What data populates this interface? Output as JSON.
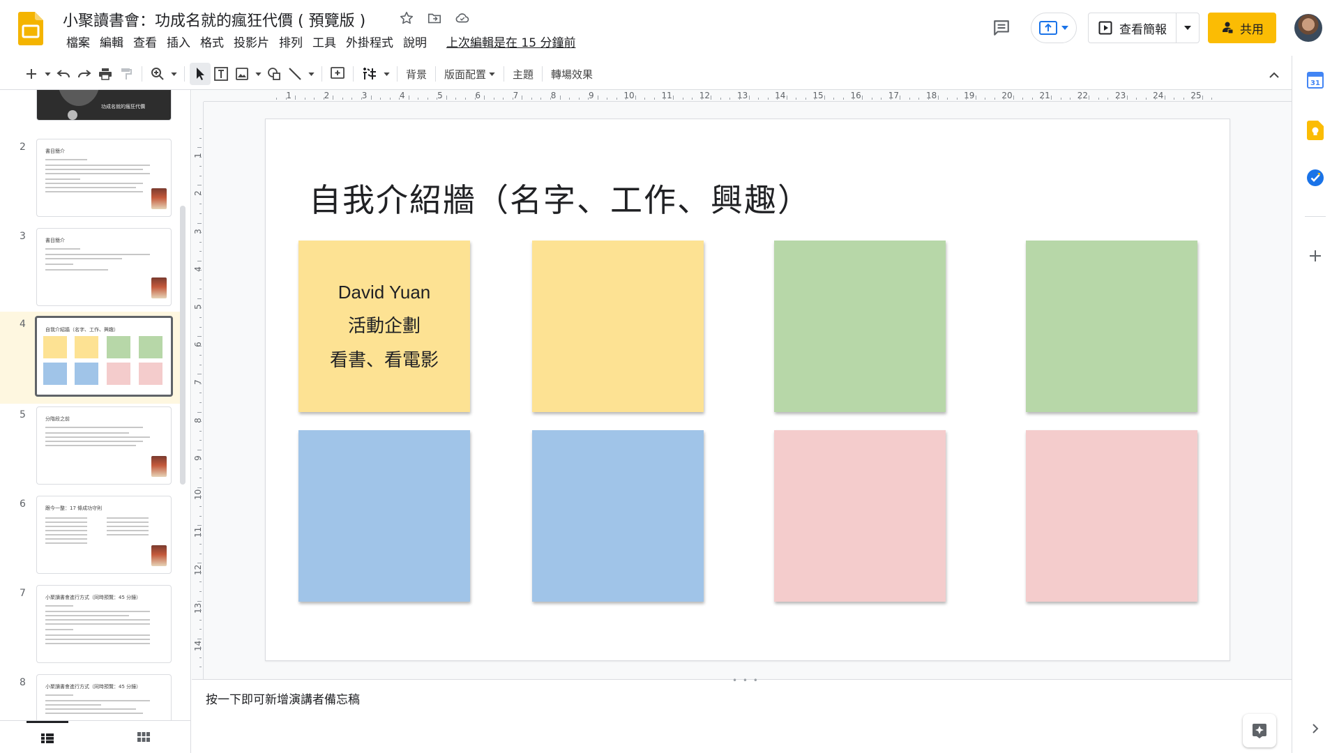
{
  "header": {
    "doc_title": "小聚讀書會：功成名就的瘋狂代價 ( 預覽版 )",
    "menu": [
      "檔案",
      "編輯",
      "查看",
      "插入",
      "格式",
      "投影片",
      "排列",
      "工具",
      "外掛程式",
      "說明"
    ],
    "last_edit": "上次編輯是在 15 分鐘前",
    "slideshow_label": "查看簡報",
    "share_label": "共用"
  },
  "toolbar": {
    "background_label": "背景",
    "layout_label": "版面配置",
    "theme_label": "主題",
    "transition_label": "轉場效果"
  },
  "filmstrip": {
    "slides": [
      {
        "num": "",
        "title": "功成名就的瘋狂代價"
      },
      {
        "num": "2",
        "title": "書目簡介"
      },
      {
        "num": "3",
        "title": "書目簡介"
      },
      {
        "num": "4",
        "title": "自我介紹牆（名字、工作、興趣）"
      },
      {
        "num": "5",
        "title": "分階段之前"
      },
      {
        "num": "6",
        "title": "跟今一整：17 條成功守則"
      },
      {
        "num": "7",
        "title": "小聚讀書會進行方式（同時預覽：45 分鐘）"
      },
      {
        "num": "8",
        "title": "小聚讀書會進行方式（同時預覽：45 分鐘）"
      }
    ],
    "active_index": 3
  },
  "ruler": {
    "h": [
      "1",
      "2",
      "3",
      "4",
      "5",
      "6",
      "7",
      "8",
      "9",
      "10",
      "11",
      "12",
      "13",
      "14",
      "15",
      "16",
      "17",
      "18",
      "19",
      "20",
      "21",
      "22",
      "23",
      "24",
      "25"
    ],
    "v": [
      "1",
      "2",
      "3",
      "4",
      "5",
      "6",
      "7",
      "8",
      "9",
      "10",
      "11",
      "12",
      "13",
      "14"
    ]
  },
  "slide": {
    "title": "自我介紹牆（名字、工作、興趣）",
    "notes": [
      {
        "color": "#fde293",
        "lines": [
          "David Yuan",
          "活動企劃",
          "看書、看電影"
        ]
      },
      {
        "color": "#fde293",
        "lines": []
      },
      {
        "color": "#b7d7a8",
        "lines": []
      },
      {
        "color": "#b7d7a8",
        "lines": []
      },
      {
        "color": "#a0c4e8",
        "lines": []
      },
      {
        "color": "#a0c4e8",
        "lines": []
      },
      {
        "color": "#f4cccc",
        "lines": []
      },
      {
        "color": "#f4cccc",
        "lines": []
      }
    ]
  },
  "speaker_notes": {
    "placeholder": "按一下即可新增演講者備忘稿"
  },
  "colors": {
    "accent_yellow": "#fbbc04",
    "note_yellow": "#fde293",
    "note_green": "#b7d7a8",
    "note_blue": "#a0c4e8",
    "note_pink": "#f4cccc"
  }
}
